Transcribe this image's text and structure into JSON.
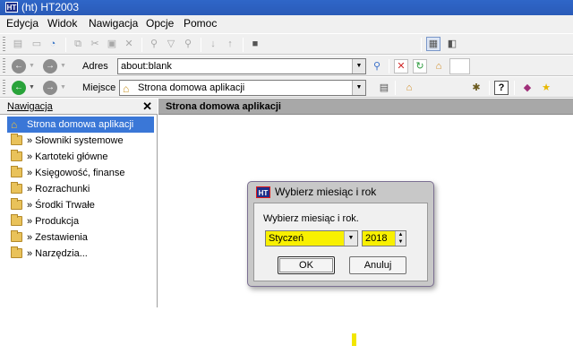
{
  "window": {
    "title": "(ht)  HT2003",
    "app_icon": "HT"
  },
  "menu": [
    "Edycja",
    "Widok",
    "Nawigacja",
    "Opcje",
    "Pomoc"
  ],
  "address_bar": {
    "label": "Adres",
    "value": "about:blank"
  },
  "location_bar": {
    "label": "Miejsce",
    "value": "Strona domowa aplikacji"
  },
  "nav": {
    "header": "Nawigacja",
    "close": "✕",
    "items": [
      "Strona domowa aplikacji",
      "» Słowniki systemowe",
      "» Kartoteki główne",
      "» Księgowość, finanse",
      "» Rozrachunki",
      "» Środki Trwałe",
      "» Produkcja",
      "» Zestawienia",
      "» Narzędzia..."
    ]
  },
  "main": {
    "header": "Strona domowa aplikacji"
  },
  "dialog": {
    "title": "Wybierz miesiąc i rok",
    "prompt": "Wybierz miesiąc i rok.",
    "month": "Styczeń",
    "year": "2018",
    "ok": "OK",
    "cancel": "Anuluj"
  },
  "colors": {
    "highlight": "#f8f000",
    "selection": "#3a77d7",
    "titlebar": "#2f66c8"
  }
}
